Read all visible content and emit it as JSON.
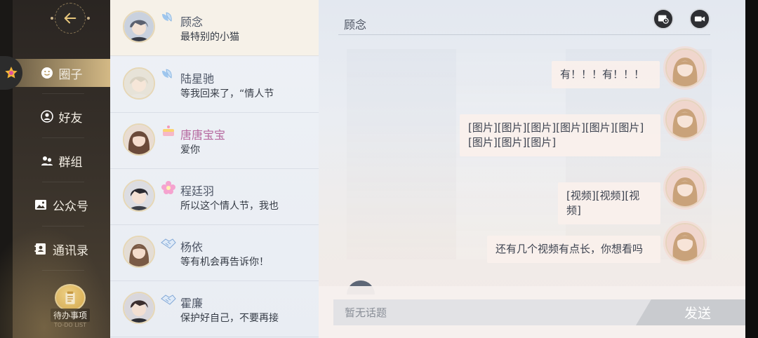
{
  "nav": {
    "items": [
      {
        "label": "圈子",
        "icon": "smile-icon",
        "active": true
      },
      {
        "label": "好友",
        "icon": "person-icon",
        "active": false
      },
      {
        "label": "群组",
        "icon": "group-icon",
        "active": false
      },
      {
        "label": "公众号",
        "icon": "image-icon",
        "active": false
      },
      {
        "label": "通讯录",
        "icon": "contacts-icon",
        "active": false
      }
    ],
    "todo_label": "待办事项",
    "todo_sub": "TO-DO LIST"
  },
  "contacts": [
    {
      "name": "顾念",
      "message": "最特别的小猫",
      "badge": "wing-badge",
      "active": true
    },
    {
      "name": "陆星驰",
      "message": "等我回来了，“情人节",
      "badge": "wing-badge",
      "active": false
    },
    {
      "name": "唐唐宝宝",
      "message": "爱你",
      "badge": "cake-badge",
      "active": false
    },
    {
      "name": "程廷羽",
      "message": "所以这个情人节，我也",
      "badge": "flower-badge",
      "active": false
    },
    {
      "name": "杨依",
      "message": "等有机会再告诉你！",
      "badge": "handshake-badge",
      "active": false
    },
    {
      "name": "霍廉",
      "message": "保护好自己，不要再接",
      "badge": "handshake-badge",
      "active": false
    }
  ],
  "chat": {
    "title": "顾念",
    "messages": [
      {
        "text": "有！！！有！！！"
      },
      {
        "text": "[图片][图片][图片][图片][图片][图片][图片][图片][图片]"
      },
      {
        "text": "[视频][视频][视频]"
      },
      {
        "text": "还有几个视频有点长，你想看吗"
      }
    ],
    "input_placeholder": "暂无话题",
    "send_label": "发送"
  },
  "colors": {
    "accent_gold": "#e9c77c",
    "sidebar_bg": "#2f2a25",
    "bubble_bg": "#f9efea"
  }
}
